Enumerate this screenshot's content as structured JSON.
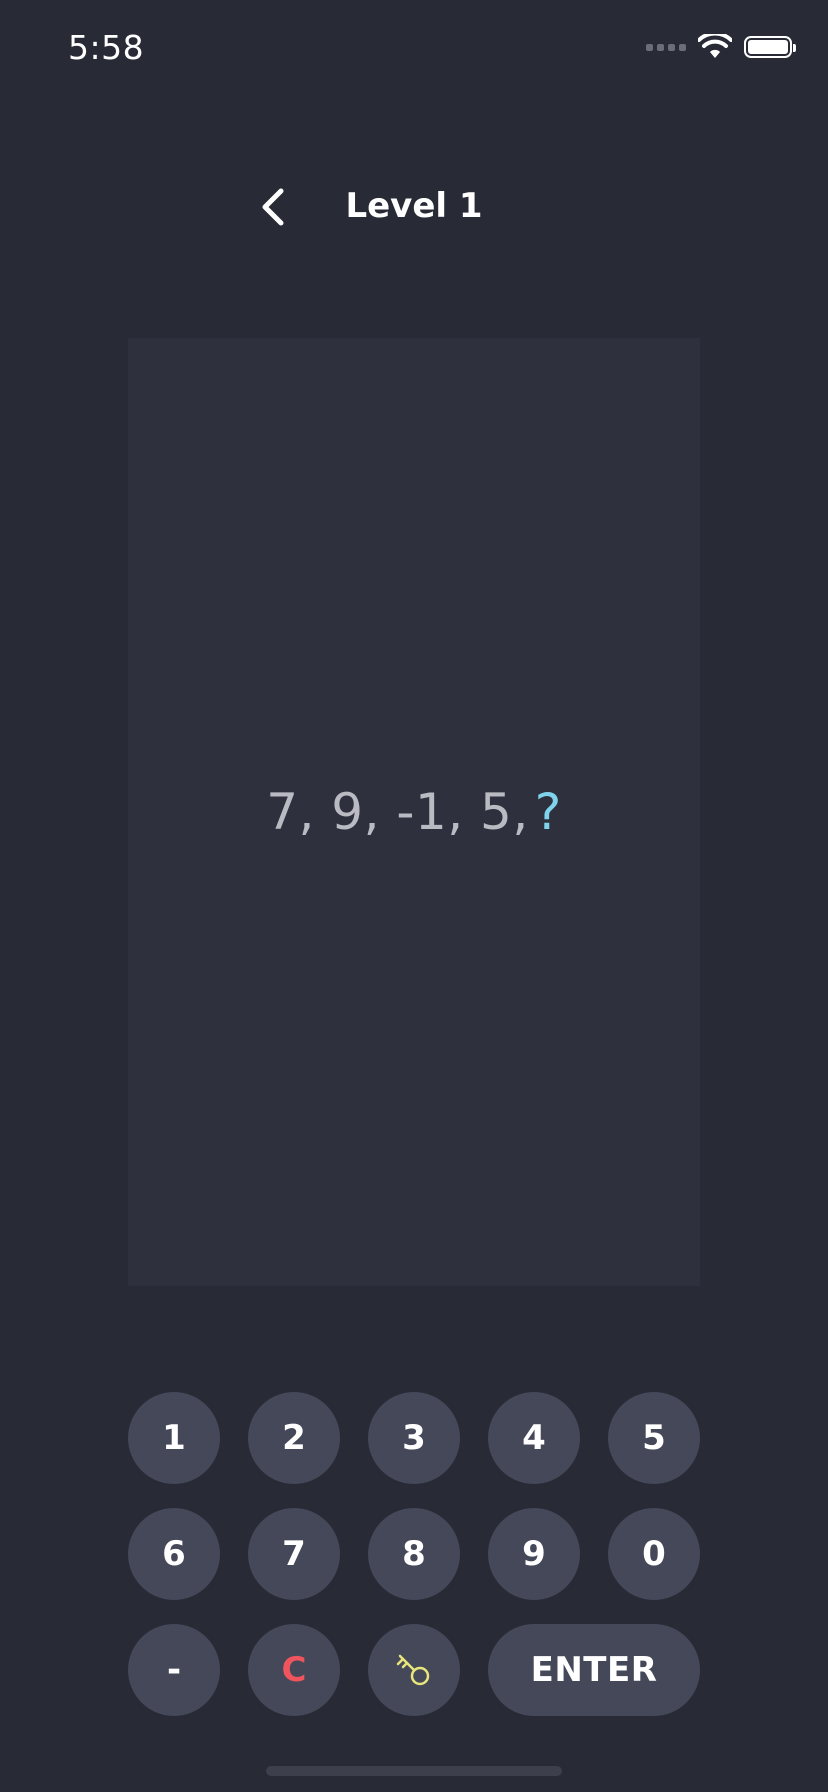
{
  "status_bar": {
    "time": "5:58"
  },
  "nav": {
    "title": "Level 1",
    "back_icon": "chevron-left-icon"
  },
  "puzzle": {
    "sequence": "7, 9, -1, 5,",
    "unknown": "?"
  },
  "keypad": {
    "row1": [
      "1",
      "2",
      "3",
      "4",
      "5"
    ],
    "row2": [
      "6",
      "7",
      "8",
      "9",
      "0"
    ],
    "minus": "-",
    "clear": "C",
    "hint_icon": "key-icon",
    "enter": "ENTER"
  },
  "colors": {
    "background": "#282a36",
    "card": "#2e303d",
    "key": "#454859",
    "accent_question": "#7fd3ec",
    "clear": "#f0545c",
    "hint": "#e8e57a"
  }
}
